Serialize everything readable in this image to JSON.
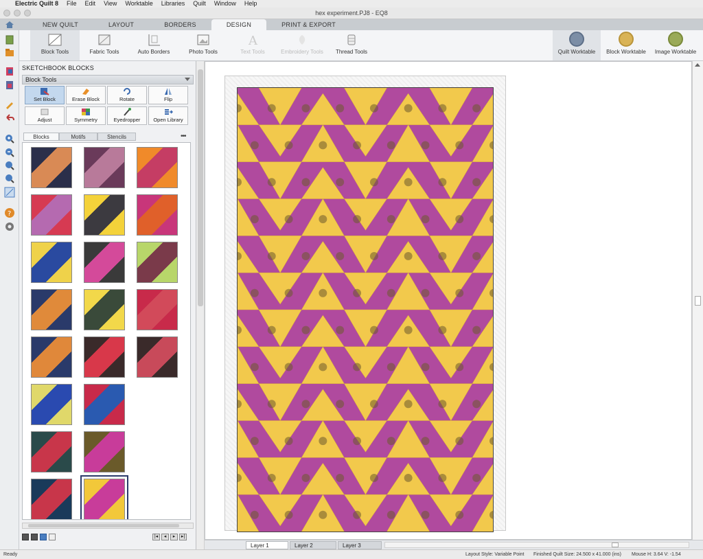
{
  "menubar": {
    "app": "Electric Quilt 8",
    "items": [
      "File",
      "Edit",
      "View",
      "Worktable",
      "Libraries",
      "Quilt",
      "Window",
      "Help"
    ]
  },
  "window": {
    "title": "hex experiment.PJ8 - EQ8"
  },
  "tabs": [
    {
      "label": "NEW QUILT"
    },
    {
      "label": "LAYOUT"
    },
    {
      "label": "BORDERS"
    },
    {
      "label": "DESIGN",
      "active": true
    },
    {
      "label": "PRINT & EXPORT"
    }
  ],
  "ribbon": {
    "tools": [
      "Block Tools",
      "Fabric Tools",
      "Auto Borders",
      "Photo Tools",
      "Text Tools",
      "Embroidery Tools",
      "Thread Tools"
    ],
    "worktables": [
      "Quilt Worktable",
      "Block Worktable",
      "Image Worktable"
    ]
  },
  "panel": {
    "title": "SKETCHBOOK BLOCKS",
    "section": "Block Tools",
    "buttons": [
      "Set Block",
      "Erase Block",
      "Rotate",
      "Flip",
      "Adjust",
      "Symmetry",
      "Eyedropper",
      "Open Library"
    ],
    "subtabs": [
      "Blocks",
      "Motifs",
      "Stencils"
    ],
    "more": "•••"
  },
  "blocks": [
    {
      "a": "#d98a55",
      "b": "#2b2f4a"
    },
    {
      "a": "#b87a9a",
      "b": "#6a3a5a"
    },
    {
      "a": "#c53d64",
      "b": "#f08a2a"
    },
    {
      "a": "#b56ab0",
      "b": "#d63a52"
    },
    {
      "a": "#3c3a40",
      "b": "#f4d23a"
    },
    {
      "a": "#e0602a",
      "b": "#c8367a"
    },
    {
      "a": "#2a4aa0",
      "b": "#efd24a"
    },
    {
      "a": "#d44a9a",
      "b": "#3a3a3a"
    },
    {
      "a": "#7a3a4a",
      "b": "#b8d66a"
    },
    {
      "a": "#e08a3a",
      "b": "#2a3a6a"
    },
    {
      "a": "#3a4a3a",
      "b": "#f2d84a"
    },
    {
      "a": "#d24a5a",
      "b": "#c82a4a"
    },
    {
      "a": "#e0883a",
      "b": "#2a3a6a"
    },
    {
      "a": "#d8384a",
      "b": "#3a2a2a"
    },
    {
      "a": "#c84a5a",
      "b": "#3a2a2a"
    },
    {
      "a": "#2a4ab0",
      "b": "#e0d86a"
    },
    {
      "a": "#2a5ab0",
      "b": "#c82a4a"
    },
    {
      "a": "#c8364a",
      "b": "#2a4a4a"
    },
    {
      "a": "#c83c9a",
      "b": "#6a5a2a"
    },
    {
      "a": "#c8364a",
      "b": "#1a3a5a"
    },
    {
      "a": "#c83c9a",
      "b": "#f2c83a"
    }
  ],
  "layers": [
    "Layer 1",
    "Layer 2",
    "Layer 3"
  ],
  "status": {
    "left": "Ready",
    "layout": "Layout Style: Variable Point",
    "size": "Finished Quilt Size: 24.500 x 41.000 (ins)",
    "mouse": "Mouse  H:  3.64   V:  -1.54"
  },
  "colors": {
    "purple": "#b04a9e",
    "yellow": "#f2c94c",
    "brown": "#6e5a2e"
  }
}
